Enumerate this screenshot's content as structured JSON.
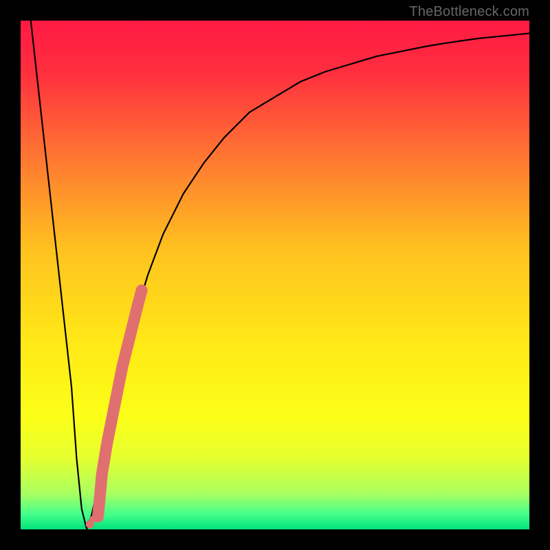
{
  "watermark": "TheBottleneck.com",
  "colors": {
    "frame": "#000000",
    "curve": "#000000",
    "marker": "#e07070",
    "gradient_stops": [
      {
        "offset": 0.0,
        "color": "#ff1a44"
      },
      {
        "offset": 0.1,
        "color": "#ff2e3e"
      },
      {
        "offset": 0.25,
        "color": "#ff6f33"
      },
      {
        "offset": 0.45,
        "color": "#ffc21f"
      },
      {
        "offset": 0.63,
        "color": "#ffe816"
      },
      {
        "offset": 0.78,
        "color": "#fbff18"
      },
      {
        "offset": 0.86,
        "color": "#e6ff30"
      },
      {
        "offset": 0.93,
        "color": "#a8ff60"
      },
      {
        "offset": 0.97,
        "color": "#44ff8b"
      },
      {
        "offset": 1.0,
        "color": "#00e37b"
      }
    ]
  },
  "chart_data": {
    "type": "line",
    "title": "",
    "xlabel": "",
    "ylabel": "",
    "xlim": [
      0,
      100
    ],
    "ylim": [
      0,
      100
    ],
    "series": [
      {
        "name": "bottleneck-curve",
        "x": [
          2,
          4,
          6,
          8,
          10,
          11,
          12,
          13,
          14,
          16,
          18,
          20,
          22,
          25,
          28,
          32,
          36,
          40,
          45,
          50,
          55,
          60,
          65,
          70,
          75,
          80,
          85,
          90,
          95,
          100
        ],
        "y": [
          100,
          82,
          64,
          46,
          28,
          14,
          4,
          0,
          3,
          12,
          22,
          32,
          40,
          50,
          58,
          66,
          72,
          77,
          82,
          85,
          88,
          90,
          91.5,
          93,
          94,
          95,
          95.8,
          96.5,
          97,
          97.5
        ]
      }
    ],
    "optimum_x": 13,
    "highlight_segment": {
      "name": "current-range",
      "x": [
        15.2,
        16,
        17,
        18,
        19,
        20,
        21,
        22,
        23,
        23.8
      ],
      "y": [
        2.5,
        11,
        17,
        22,
        27,
        32,
        36,
        40,
        44,
        47
      ]
    },
    "highlight_dots": {
      "name": "near-optimum",
      "x": [
        13.6,
        14.2,
        14.8
      ],
      "y": [
        1.0,
        2.0,
        4.0
      ]
    }
  }
}
